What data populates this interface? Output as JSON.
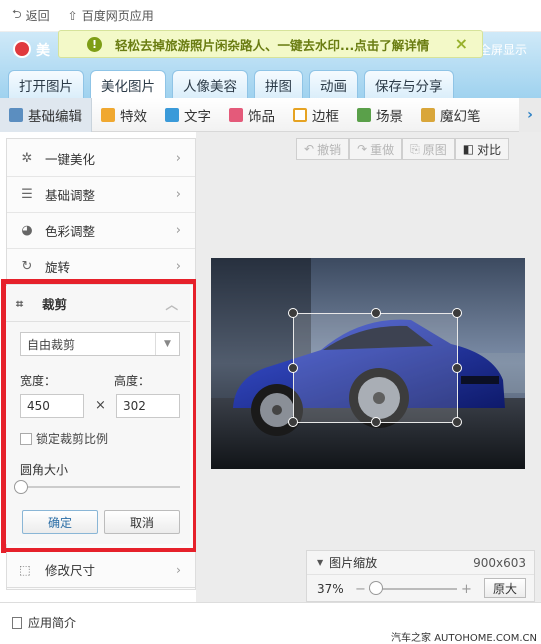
{
  "nav": {
    "back": "返回",
    "app_home": "百度网页应用"
  },
  "notice": {
    "text": "轻松去掉旅游照片闲杂路人、一键去水印...点击了解详情"
  },
  "header": {
    "logo_text": "美",
    "fullscreen": "全屏显示"
  },
  "tabs": [
    "打开图片",
    "美化图片",
    "人像美容",
    "拼图",
    "动画",
    "保存与分享"
  ],
  "tools": [
    "基础编辑",
    "特效",
    "文字",
    "饰品",
    "边框",
    "场景",
    "魔幻笔"
  ],
  "edit_actions": {
    "undo": "撤销",
    "redo": "重做",
    "original": "原图",
    "compare": "对比"
  },
  "left_menu": [
    "一键美化",
    "基础调整",
    "色彩调整",
    "旋转"
  ],
  "crop": {
    "title": "裁剪",
    "mode": "自由裁剪",
    "width_label": "宽度：",
    "height_label": "高度：",
    "width": "450",
    "height": "302",
    "times": "×",
    "lock_ratio": "锁定裁剪比例",
    "corner_label": "圆角大小",
    "corner_value": 0,
    "ok": "确定",
    "cancel": "取消"
  },
  "resize_label": "修改尺寸",
  "zoom": {
    "title": "图片缩放",
    "dims": "900x603",
    "percent": "37%",
    "minus": "−",
    "plus": "+",
    "original": "原大"
  },
  "footer": {
    "intro": "应用简介",
    "watermark": "汽车之家  AUTOHOME.COM.CN"
  },
  "colors": {
    "accent_red": "#e6212b",
    "header_blue": "#9fd2ef",
    "notice_bg": "#f3f9c8"
  }
}
